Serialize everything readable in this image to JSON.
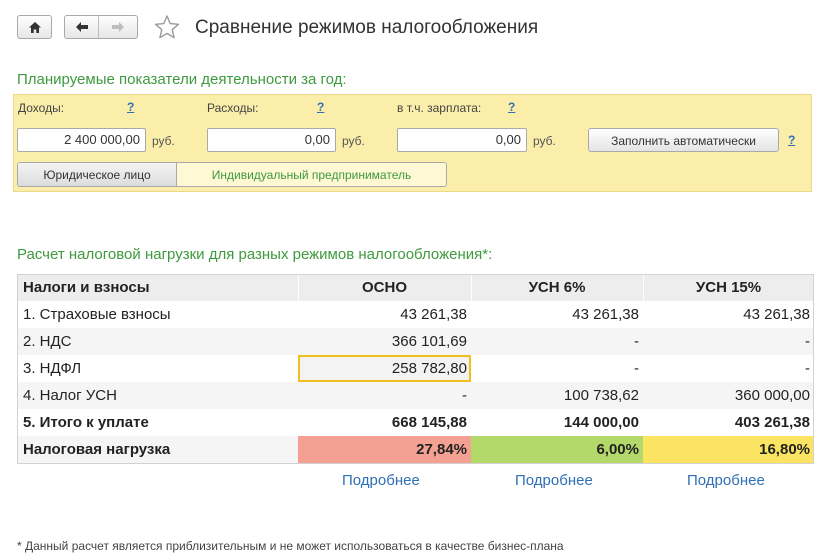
{
  "header": {
    "title": "Сравнение режимов налогообложения"
  },
  "plan": {
    "section_title": "Планируемые показатели деятельности за год:",
    "income": {
      "label": "Доходы:",
      "help": "?",
      "value": "2 400 000,00",
      "unit": "руб."
    },
    "expenses": {
      "label": "Расходы:",
      "help": "?",
      "value": "0,00",
      "unit": "руб."
    },
    "salary": {
      "label": "в т.ч. зарплата:",
      "help": "?",
      "value": "0,00",
      "unit": "руб."
    },
    "fill_button": "Заполнить автоматически",
    "fill_help": "?",
    "entity_types": [
      {
        "label": "Юридическое лицо",
        "selected": true
      },
      {
        "label": "Индивидуальный предприниматель",
        "selected": false
      }
    ]
  },
  "calc": {
    "section_title": "Расчет налоговой нагрузки для разных режимов налогообложения*:",
    "columns": [
      "Налоги и взносы",
      "ОСНО",
      "УСН 6%",
      "УСН 15%"
    ],
    "rows": [
      [
        "1. Страховые взносы",
        "43 261,38",
        "43 261,38",
        "43 261,38"
      ],
      [
        "2. НДС",
        "366 101,69",
        "-",
        "-"
      ],
      [
        "3. НДФЛ",
        "258 782,80",
        "-",
        "-"
      ],
      [
        "4. Налог УСН",
        "-",
        "100 738,62",
        "360 000,00"
      ],
      [
        "5. Итого к уплате",
        "668 145,88",
        "144 000,00",
        "403 261,38"
      ]
    ],
    "burden": {
      "label": "Налоговая нагрузка",
      "values": [
        "27,84%",
        "6,00%",
        "16,80%"
      ]
    },
    "burden_colors": [
      "#f4a193",
      "#b3d96a",
      "#fbe461"
    ],
    "details_link": "Подробнее"
  },
  "footnote": "* Данный расчет является приблизительным и не может использоваться в качестве бизнес-плана"
}
